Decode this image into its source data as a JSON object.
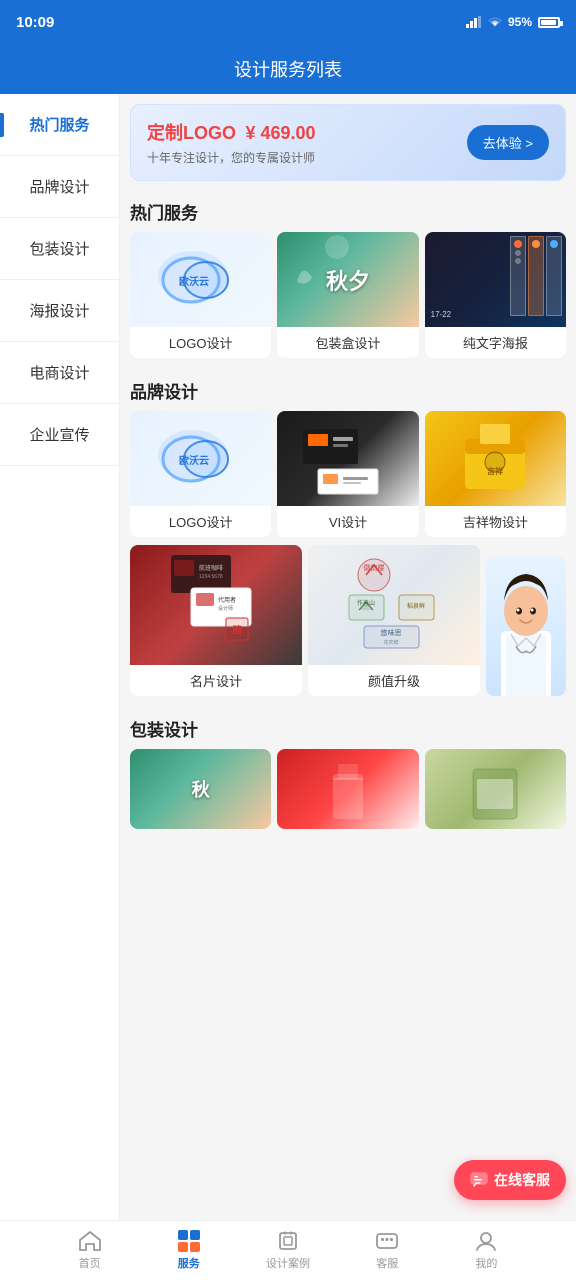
{
  "status": {
    "time": "10:09",
    "battery": "95%"
  },
  "header": {
    "title": "设计服务列表"
  },
  "sidebar": {
    "items": [
      {
        "label": "热门服务",
        "active": true
      },
      {
        "label": "品牌设计",
        "active": false
      },
      {
        "label": "包装设计",
        "active": false
      },
      {
        "label": "海报设计",
        "active": false
      },
      {
        "label": "电商设计",
        "active": false
      },
      {
        "label": "企业宣传",
        "active": false
      }
    ]
  },
  "banner": {
    "title": "定制LOGO",
    "price": "¥ 469.00",
    "subtitle": "十年专注设计，您的专属设计师",
    "button": "去体验 >"
  },
  "hot_section": {
    "title": "热门服务",
    "items": [
      {
        "label": "LOGO设计",
        "img_type": "img-logo"
      },
      {
        "label": "包装盒设计",
        "img_type": "img-midautumn"
      },
      {
        "label": "纯文字海报",
        "img_type": "img-night"
      }
    ]
  },
  "brand_section": {
    "title": "品牌设计",
    "items_row1": [
      {
        "label": "LOGO设计",
        "img_type": "img-logo"
      },
      {
        "label": "VI设计",
        "img_type": "img-vi"
      },
      {
        "label": "吉祥物设计",
        "img_type": "img-auspicious"
      }
    ],
    "items_row2": [
      {
        "label": "名片设计",
        "img_type": "img-namecard"
      },
      {
        "label": "颜值升级",
        "img_type": "img-value"
      }
    ]
  },
  "packaging_section": {
    "title": "包装设计",
    "items": [
      {
        "label": "",
        "img_type": "img-pkg1"
      },
      {
        "label": "",
        "img_type": "img-pkg2"
      },
      {
        "label": "",
        "img_type": "img-pkg3"
      }
    ]
  },
  "customer_service": {
    "label": "在线客服"
  },
  "bottom_nav": {
    "items": [
      {
        "label": "首页",
        "active": false,
        "icon": "home"
      },
      {
        "label": "服务",
        "active": true,
        "icon": "service"
      },
      {
        "label": "设计案例",
        "active": false,
        "icon": "cases"
      },
      {
        "label": "客服",
        "active": false,
        "icon": "support"
      },
      {
        "label": "我的",
        "active": false,
        "icon": "profile"
      }
    ]
  },
  "system_nav": {
    "back": "‹",
    "home": "○",
    "recents": "|||"
  }
}
